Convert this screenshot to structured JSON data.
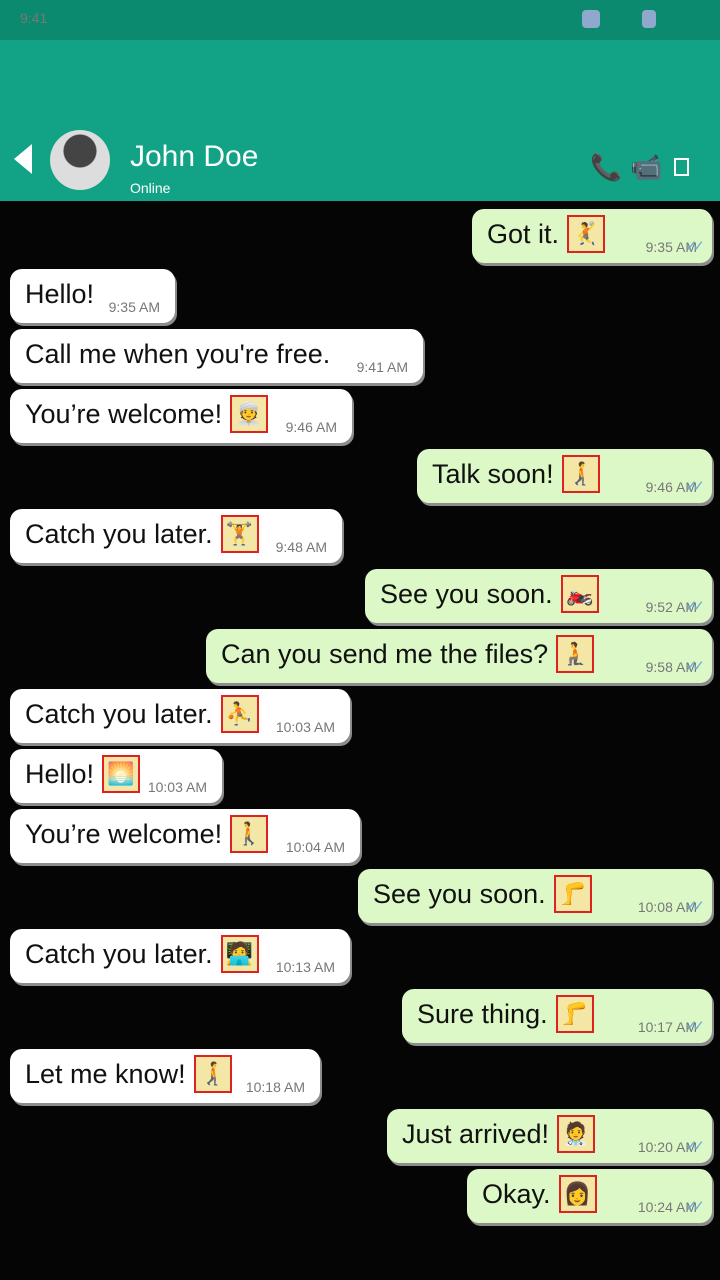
{
  "status_bar": {
    "time": "9:41"
  },
  "header": {
    "contact_name": "John Doe",
    "status": "Online"
  },
  "messages": [
    {
      "dir": "out",
      "text": "Got it.",
      "emoji": "🤾",
      "time": "9:35 AM"
    },
    {
      "dir": "in",
      "text": "Hello!",
      "emoji": "",
      "time": "9:35 AM"
    },
    {
      "dir": "in",
      "text": "Call me when you're free.",
      "emoji": "",
      "time": "9:41 AM"
    },
    {
      "dir": "in",
      "text": "You’re welcome!",
      "emoji": "👳",
      "time": "9:46 AM"
    },
    {
      "dir": "out",
      "text": "Talk soon!",
      "emoji": "🚶‍➡️",
      "time": "9:46 AM"
    },
    {
      "dir": "in",
      "text": "Catch you later.",
      "emoji": "🏋️",
      "time": "9:48 AM"
    },
    {
      "dir": "out",
      "text": "See you soon.",
      "emoji": "🏍️",
      "time": "9:52 AM"
    },
    {
      "dir": "out",
      "text": "Can you send me the files?",
      "emoji": "🧎",
      "time": "9:58 AM"
    },
    {
      "dir": "in",
      "text": "Catch you later.",
      "emoji": "⛹️",
      "time": "10:03 AM"
    },
    {
      "dir": "in",
      "text": "Hello!",
      "emoji": "🌅",
      "time": "10:03 AM"
    },
    {
      "dir": "in",
      "text": "You’re welcome!",
      "emoji": "🚶",
      "time": "10:04 AM"
    },
    {
      "dir": "out",
      "text": "See you soon.",
      "emoji": "🦵",
      "time": "10:08 AM"
    },
    {
      "dir": "in",
      "text": "Catch you later.",
      "emoji": "🧑‍💻",
      "time": "10:13 AM"
    },
    {
      "dir": "out",
      "text": "Sure thing.",
      "emoji": "🦵",
      "time": "10:17 AM"
    },
    {
      "dir": "in",
      "text": "Let me know!",
      "emoji": "🚶‍➡️",
      "time": "10:18 AM"
    },
    {
      "dir": "out",
      "text": "Just arrived!",
      "emoji": "🧑‍⚕️",
      "time": "10:20 AM"
    },
    {
      "dir": "out",
      "text": "Okay.",
      "emoji": "👩",
      "time": "10:24 AM"
    }
  ]
}
